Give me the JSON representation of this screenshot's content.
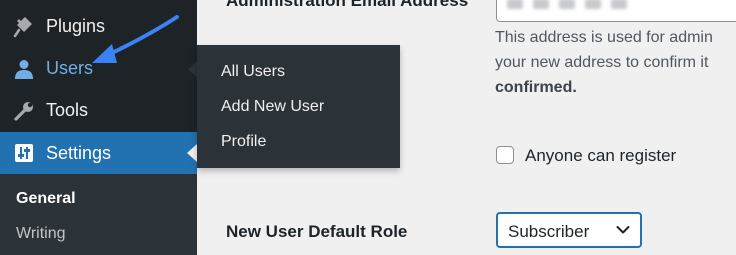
{
  "sidebar": {
    "items": [
      {
        "label": "Plugins",
        "icon": "plugin-icon"
      },
      {
        "label": "Users",
        "icon": "user-icon"
      },
      {
        "label": "Tools",
        "icon": "wrench-icon"
      },
      {
        "label": "Settings",
        "icon": "settings-sliders-icon"
      }
    ],
    "submenu": [
      {
        "label": "General"
      },
      {
        "label": "Writing"
      }
    ]
  },
  "users_flyout": {
    "items": [
      {
        "label": "All Users"
      },
      {
        "label": "Add New User"
      },
      {
        "label": "Profile"
      }
    ]
  },
  "settings": {
    "admin_email": {
      "label": "Administration Email Address",
      "description_line1": "This address is used for admin",
      "description_line2": "your new address to confirm it",
      "description_line3": "confirmed."
    },
    "membership": {
      "checkbox_label": "Anyone can register",
      "checked": false
    },
    "default_role": {
      "label": "New User Default Role",
      "selected": "Subscriber"
    }
  },
  "colors": {
    "sidebar_bg": "#1d2327",
    "flyout_bg": "#2c3338",
    "accent": "#2271b1",
    "highlight_text": "#72aee6",
    "annotation_arrow": "#3b82f6",
    "page_bg": "#f0f0f1"
  }
}
